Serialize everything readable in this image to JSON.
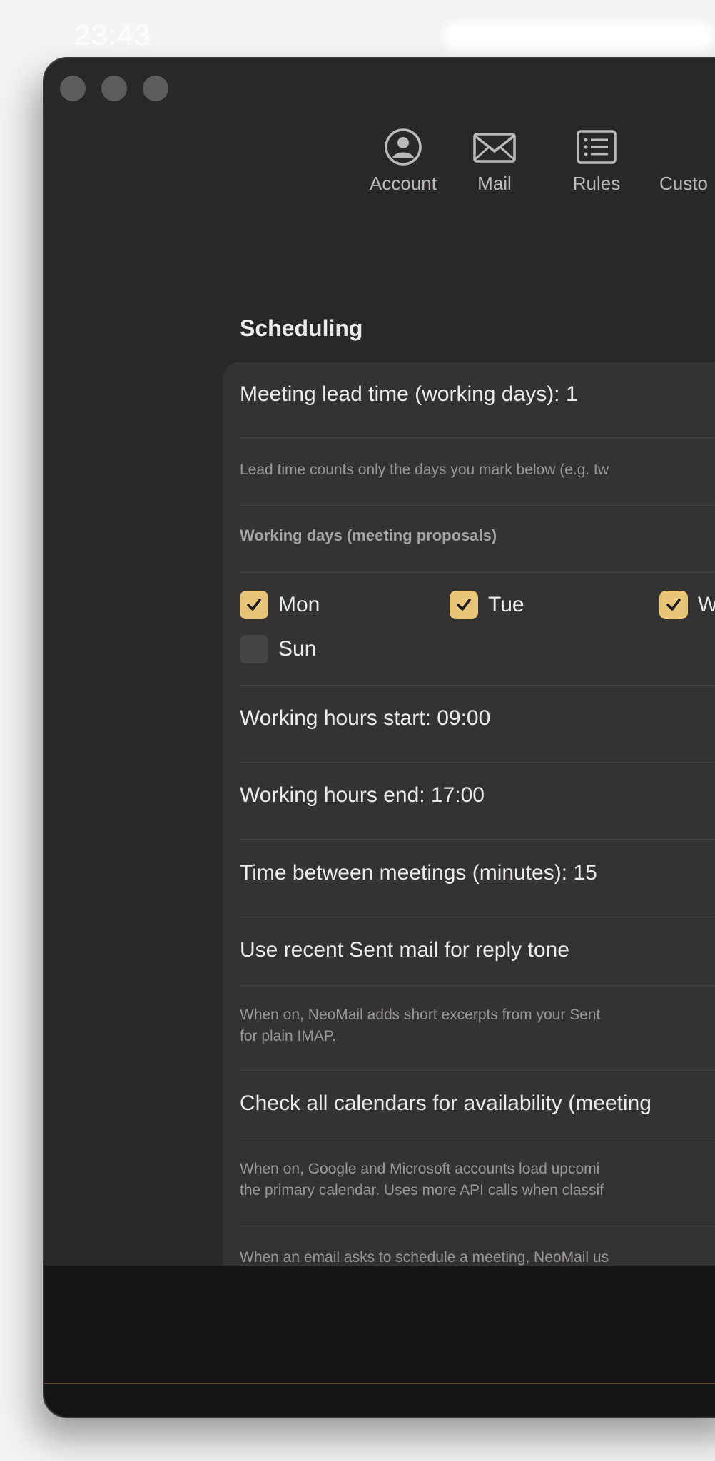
{
  "status": {
    "time": "23:43"
  },
  "toolbar": {
    "items": [
      {
        "label": "Account"
      },
      {
        "label": "Mail"
      },
      {
        "label": "Rules"
      },
      {
        "label": "Custo"
      }
    ]
  },
  "section": {
    "title": "Scheduling"
  },
  "settings": {
    "lead_time": "Meeting lead time (working days): 1",
    "lead_time_note": "Lead time counts only the days you mark below (e.g. tw",
    "working_days_header": "Working days (meeting proposals)",
    "days": [
      {
        "label": "Mon",
        "checked": true
      },
      {
        "label": "Tue",
        "checked": true
      },
      {
        "label": "W",
        "checked": true
      },
      {
        "label": "Sun",
        "checked": false
      }
    ],
    "hours_start": "Working hours start: 09:00",
    "hours_end": "Working hours end: 17:00",
    "time_between": "Time between meetings (minutes): 15",
    "sent_mail_tone": "Use recent Sent mail for reply tone",
    "sent_mail_note_1": "When on, NeoMail adds short excerpts from your Sent",
    "sent_mail_note_2": "for plain IMAP.",
    "check_calendars": "Check all calendars for availability (meeting",
    "calendars_note_1": "When on, Google and Microsoft accounts load upcomi",
    "calendars_note_2": "the primary calendar. Uses more API calls when classif",
    "schedule_note": "When an email asks to schedule a meeting, NeoMail us"
  },
  "colors": {
    "accent": "#e9c57a",
    "window_bg": "#2a2827",
    "card_bg": "#353332"
  },
  "icons": {
    "account": "person-circle-icon",
    "mail": "envelope-icon",
    "rules": "list-icon",
    "checkbox": "checkmark-icon"
  }
}
